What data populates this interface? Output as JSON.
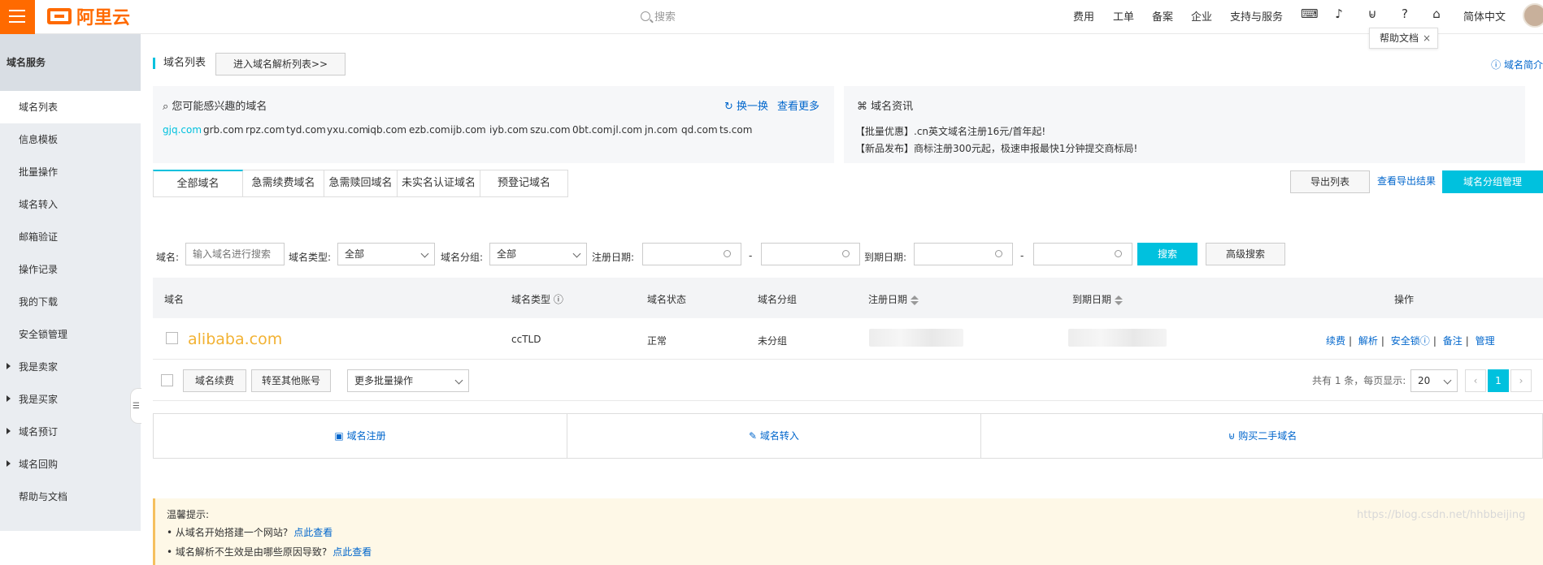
{
  "header": {
    "brand": "阿里云",
    "search_placeholder": "搜索",
    "nav": [
      "费用",
      "工单",
      "备案",
      "企业",
      "支持与服务",
      "简体中文"
    ],
    "tooltip": "帮助文档",
    "tooltip_close": "×",
    "icons": [
      "terminal-icon",
      "bell-icon",
      "cart-icon",
      "help-icon",
      "home-icon"
    ]
  },
  "sidebar": {
    "title": "域名服务",
    "items": [
      {
        "label": "域名列表",
        "active": true
      },
      {
        "label": "信息模板"
      },
      {
        "label": "批量操作"
      },
      {
        "label": "域名转入"
      },
      {
        "label": "邮箱验证"
      },
      {
        "label": "操作记录"
      },
      {
        "label": "我的下载"
      },
      {
        "label": "安全锁管理"
      },
      {
        "label": "我是卖家",
        "expandable": true
      },
      {
        "label": "我是买家",
        "expandable": true
      },
      {
        "label": "域名预订",
        "expandable": true
      },
      {
        "label": "域名回购",
        "expandable": true
      },
      {
        "label": "帮助与文档"
      }
    ]
  },
  "page": {
    "title": "域名列表",
    "resolve_button": "进入域名解析列表>>",
    "intro_link": "域名简介"
  },
  "interest": {
    "title": "您可能感兴趣的域名",
    "refresh": "换一换",
    "more": "查看更多",
    "domains": [
      "gjq.com",
      "grb.com",
      "rpz.com",
      "tyd.com",
      "yxu.com",
      "iqb.com",
      "ezb.com",
      "ijb.com",
      "iyb.com",
      "szu.com",
      "0bt.com",
      "jl.com",
      "jn.com",
      "qd.com",
      "ts.com"
    ]
  },
  "news": {
    "title": "域名资讯",
    "lines": [
      "【批量优惠】.cn英文域名注册16元/首年起!",
      "【新品发布】商标注册300元起，极速申报最快1分钟提交商标局!"
    ]
  },
  "tabs": [
    "全部域名",
    "急需续费域名",
    "急需赎回域名",
    "未实名认证域名",
    "预登记域名"
  ],
  "toolbar": {
    "export": "导出列表",
    "view_export": "查看导出结果",
    "group_manage": "域名分组管理"
  },
  "filters": {
    "domain_label": "域名:",
    "domain_placeholder": "输入域名进行搜索",
    "type_label": "域名类型:",
    "type_value": "全部",
    "group_label": "域名分组:",
    "group_value": "全部",
    "reg_date_label": "注册日期:",
    "expire_date_label": "到期日期:",
    "date_separator": "-",
    "search_button": "搜索",
    "advanced_button": "高级搜索"
  },
  "table": {
    "headers": [
      "域名",
      "域名类型",
      "域名状态",
      "域名分组",
      "注册日期",
      "到期日期",
      "操作"
    ],
    "rows": [
      {
        "domain": "alibaba.com",
        "type": "ccTLD",
        "status": "正常",
        "group": "未分组",
        "actions": [
          "续费",
          "解析",
          "安全锁",
          "备注",
          "管理"
        ]
      }
    ]
  },
  "batch": {
    "renew": "域名续费",
    "transfer": "转至其他账号",
    "more": "更多批量操作",
    "pager_info": "共有 1 条，每页显示:",
    "page_size": "20",
    "prev": "‹",
    "current": "1",
    "next": "›"
  },
  "bottom": [
    "域名注册",
    "域名转入",
    "购买二手域名"
  ],
  "tip": {
    "title": "温馨提示:",
    "lines": [
      {
        "text": "• 从域名开始搭建一个网站?",
        "link": "点此查看"
      },
      {
        "text": "• 域名解析不生效是由哪些原因导致?",
        "link": "点此查看"
      }
    ]
  },
  "watermark": "https://blog.csdn.net/hhbbeijing"
}
